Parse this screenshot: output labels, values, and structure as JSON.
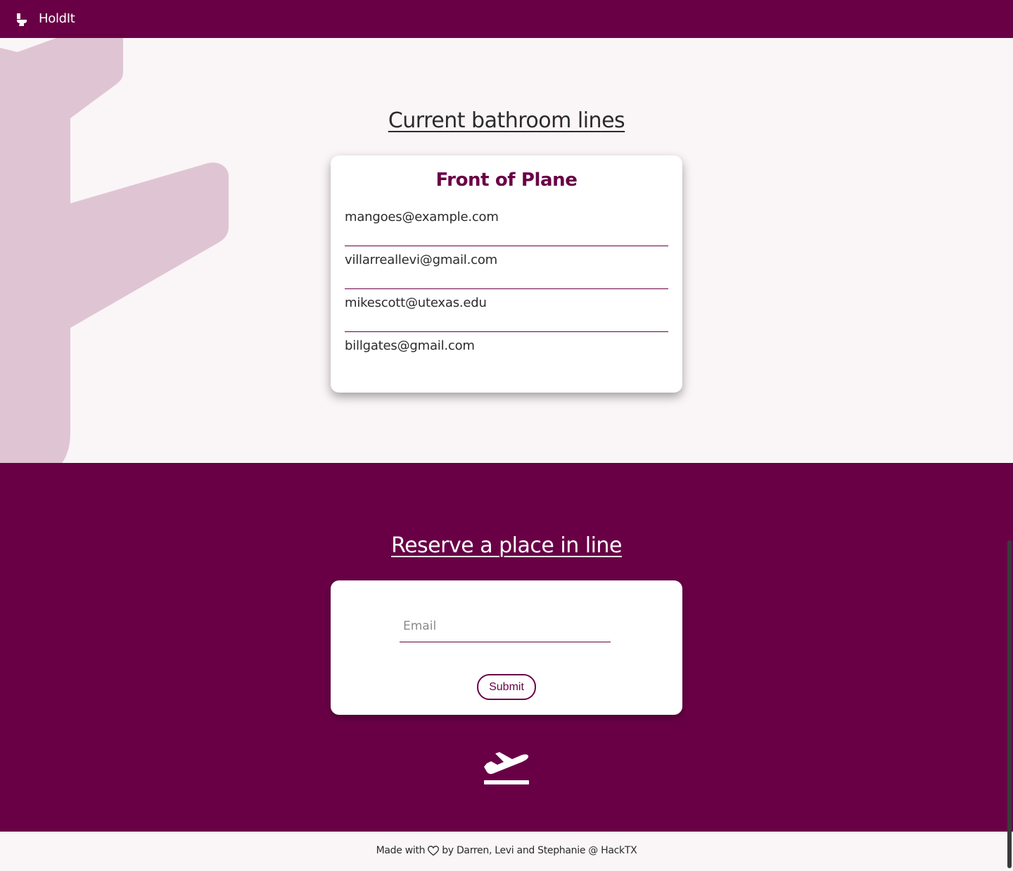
{
  "nav": {
    "brand": "HoldIt",
    "brand_icon": "toilet-icon"
  },
  "lines": {
    "title": "Current bathroom lines",
    "queue": {
      "name": "Front of Plane",
      "entries": [
        "mangoes@example.com",
        "villarreallevi@gmail.com",
        "mikescott@utexas.edu",
        "billgates@gmail.com"
      ]
    }
  },
  "reserve": {
    "title": "Reserve a place in line",
    "email_placeholder": "Email",
    "email_value": "",
    "submit_label": "Submit",
    "icon": "airplane-takeoff-icon"
  },
  "footer": {
    "made_with": "Made with",
    "credits": "by Darren, Levi and Stephanie @ HackTX",
    "icon": "heart-icon"
  },
  "colors": {
    "brand": "#690046",
    "background": "#faf5f7",
    "plane_decoration": "#dfc5d3",
    "text": "#2b2b2b"
  }
}
